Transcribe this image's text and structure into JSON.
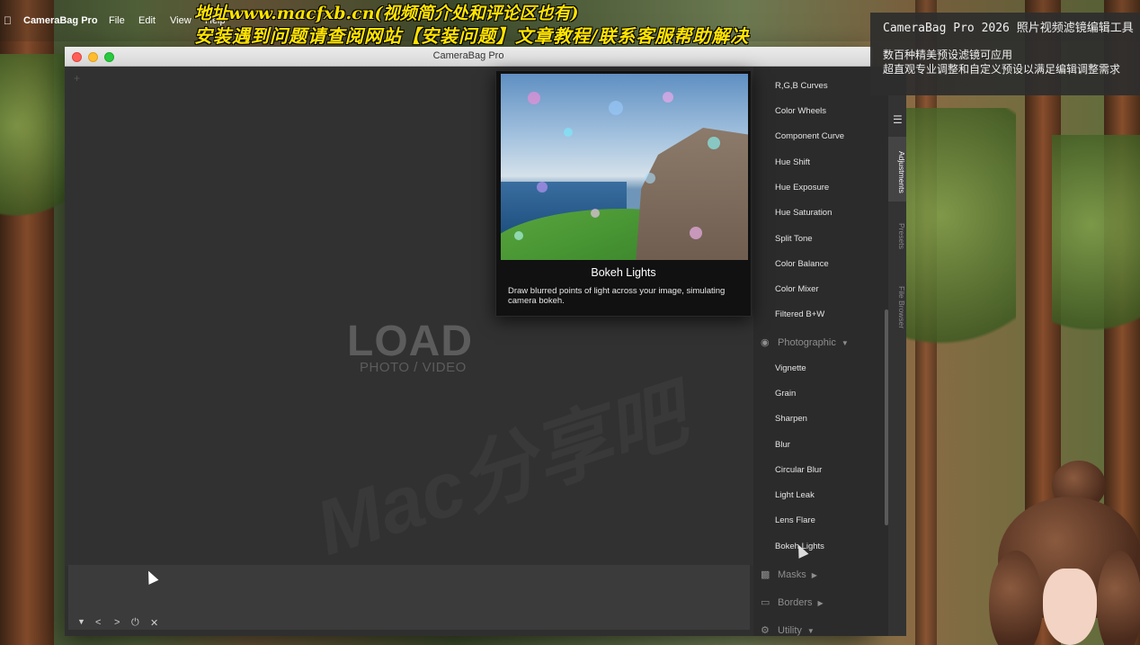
{
  "menubar": {
    "apple": "",
    "app_name": "CameraBag Pro",
    "menus": [
      "File",
      "Edit",
      "View",
      "Help"
    ]
  },
  "overlay": {
    "line1": "地址www.macfxb.cn(视频简介处和评论区也有)",
    "line2": "安装遇到问题请查阅网站【安装问题】文章教程/联系客服帮助解决"
  },
  "infobox": {
    "title": "CameraBag Pro 2026  照片视频滤镜编辑工具",
    "line1": "数百种精美预设滤镜可应用",
    "line2": "超直观专业调整和自定义预设以满足编辑调整需求"
  },
  "window": {
    "title": "CameraBag Pro"
  },
  "canvas": {
    "load_title": "LOAD",
    "load_subtitle": "PHOTO / VIDEO",
    "watermark": "Mac分享吧"
  },
  "filmstrip": {
    "controls": [
      "▼",
      "<",
      ">",
      "⏻",
      "✕"
    ]
  },
  "panel": {
    "items_top": [
      "R,G,B Curves",
      "Color Wheels",
      "Component Curve",
      "Hue Shift",
      "Hue Exposure",
      "Hue Saturation",
      "Split Tone",
      "Color Balance",
      "Color Mixer",
      "Filtered B+W"
    ],
    "section_photographic": "Photographic",
    "items_photo": [
      "Vignette",
      "Grain",
      "Sharpen",
      "Blur",
      "Circular Blur",
      "Light Leak",
      "Lens Flare",
      "Bokeh Lights"
    ],
    "section_masks": "Masks",
    "section_borders": "Borders",
    "section_utility": "Utility"
  },
  "tabs": {
    "adjustments": "Adjustments",
    "presets": "Presets",
    "file_browser": "File Browser"
  },
  "tooltip": {
    "title": "Bokeh Lights",
    "description": "Draw blurred points of light across your image, simulating camera bokeh."
  }
}
